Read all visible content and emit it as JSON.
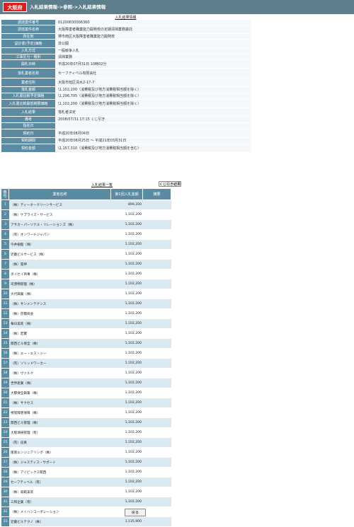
{
  "header": {
    "prefecture": "大阪府",
    "breadcrumb": "入札結果情報->参照->入札結果情報"
  },
  "info": {
    "caption": "入札結果情報",
    "rows": [
      {
        "label": "調達案件番号",
        "value": "01200830006360"
      },
      {
        "label": "調達案件名称",
        "value": "大阪障害者職業能力開発校の定期清掃業務委託"
      },
      {
        "label": "所在地",
        "value": "堺市南区大阪障害者職業能力開発校"
      },
      {
        "label": "設計書(予定)価格",
        "value": "非公開"
      },
      {
        "label": "入札方式",
        "value": "一般競争入札"
      },
      {
        "label": "工事区分・種別",
        "value": "清掃業務"
      },
      {
        "label": "開札日時",
        "value": "平成20年07月31日 10時02分"
      },
      {
        "label": "落札業者名称",
        "value": "セーフティベル有限会社"
      },
      {
        "label": "業者住所",
        "value": "大阪市旭区清水2-17-7"
      },
      {
        "label": "落札金額",
        "value": "\\1,102,200（消費税及び地方消費税相当額を除く）"
      },
      {
        "label": "入札書比較予定価格",
        "value": "\\1,296,705（消費税及び地方消費税相当額を除く）"
      },
      {
        "label": "入札書比較最低制限価格",
        "value": "\\1,102,200（消費税及び地方消費税相当額を除く）"
      },
      {
        "label": "入札結果",
        "value": "落札者決定"
      },
      {
        "label": "備考",
        "value": "2008/07/31 17:15 くじ引き"
      },
      {
        "label": "指名日",
        "value": ""
      },
      {
        "label": "契約日",
        "value": "平成20年08月04日"
      },
      {
        "label": "契約期間",
        "value": "平成20年08月25日 ～ 平成21年03月31日"
      },
      {
        "label": "契約金額",
        "value": "\\1,157,310（消費税及び地方消費税相当額を含む）"
      }
    ]
  },
  "results": {
    "title": "入札結果一覧",
    "lottery_button": "くじ引き結果",
    "columns": [
      "番号",
      "業者名称",
      "第1回入札金額",
      "摘要"
    ],
    "rows": [
      {
        "no": "1",
        "name": "（株）ティーオークリーンサービス",
        "price": "899,200"
      },
      {
        "no": "2",
        "name": "（株）ケプライズ・サービス",
        "price": "1,102,200"
      },
      {
        "no": "3",
        "name": "アサカ・パーソナル・リレーションズ（株）",
        "price": "1,102,200"
      },
      {
        "no": "4",
        "name": "（有）オンワードジャパン",
        "price": "1,102,200"
      },
      {
        "no": "5",
        "name": "今井樹脂（株）",
        "price": "1,102,200"
      },
      {
        "no": "6",
        "name": "近畿ビルサービス（株）",
        "price": "1,102,200"
      },
      {
        "no": "7",
        "name": "（株）雲神",
        "price": "1,102,200"
      },
      {
        "no": "8",
        "name": "ダイセイ商事（株）",
        "price": "1,102,200"
      },
      {
        "no": "9",
        "name": "司港物管理（株）",
        "price": "1,102,200"
      },
      {
        "no": "10",
        "name": "大代興業（株）",
        "price": "1,102,200"
      },
      {
        "no": "11",
        "name": "（株）サンメンテナンス",
        "price": "1,102,200"
      },
      {
        "no": "12",
        "name": "（株）京都商会",
        "price": "1,102,200"
      },
      {
        "no": "13",
        "name": "毎日美装（株）",
        "price": "1,102,200"
      },
      {
        "no": "14",
        "name": "（株）宏寶",
        "price": "1,102,200"
      },
      {
        "no": "15",
        "name": "関西ビル保全（株）",
        "price": "1,102,200"
      },
      {
        "no": "16",
        "name": "（株）エー・エス・ジー",
        "price": "1,102,200"
      },
      {
        "no": "17",
        "name": "（有）ソリッドワーカー",
        "price": "1,102,200"
      },
      {
        "no": "18",
        "name": "（株）ヴァルク",
        "price": "1,102,200"
      },
      {
        "no": "19",
        "name": "世界産業（株）",
        "price": "1,102,200"
      },
      {
        "no": "20",
        "name": "大都保全興業（株）",
        "price": "1,102,200"
      },
      {
        "no": "21",
        "name": "（株）サクセス",
        "price": "1,102,200"
      },
      {
        "no": "22",
        "name": "視覚障害保障（株）",
        "price": "1,102,200"
      },
      {
        "no": "23",
        "name": "関西ビル管理（株）",
        "price": "1,102,200"
      },
      {
        "no": "24",
        "name": "大阪清掃管理（有）",
        "price": "1,102,200"
      },
      {
        "no": "25",
        "name": "（有）良真",
        "price": "1,102,200"
      },
      {
        "no": "26",
        "name": "阪南エンジニアリング（株）",
        "price": "1,102,200"
      },
      {
        "no": "27",
        "name": "（株）ジャスティス・サポート",
        "price": "1,102,200"
      },
      {
        "no": "28",
        "name": "（株）アイピックス関西",
        "price": "1,102,200"
      },
      {
        "no": "29",
        "name": "セーフティベル（有）",
        "price": "1,102,200"
      },
      {
        "no": "30",
        "name": "（株）高範美装",
        "price": "1,102,200"
      },
      {
        "no": "31",
        "name": "三和企業（有）",
        "price": "1,102,200"
      },
      {
        "no": "32",
        "name": "（株）メイハンコーポレーション",
        "price": "1,102,200"
      },
      {
        "no": "33",
        "name": "近畿ビルテクノ（株）",
        "price": "1,135,900"
      }
    ]
  },
  "footer": {
    "back_button": "戻る"
  }
}
